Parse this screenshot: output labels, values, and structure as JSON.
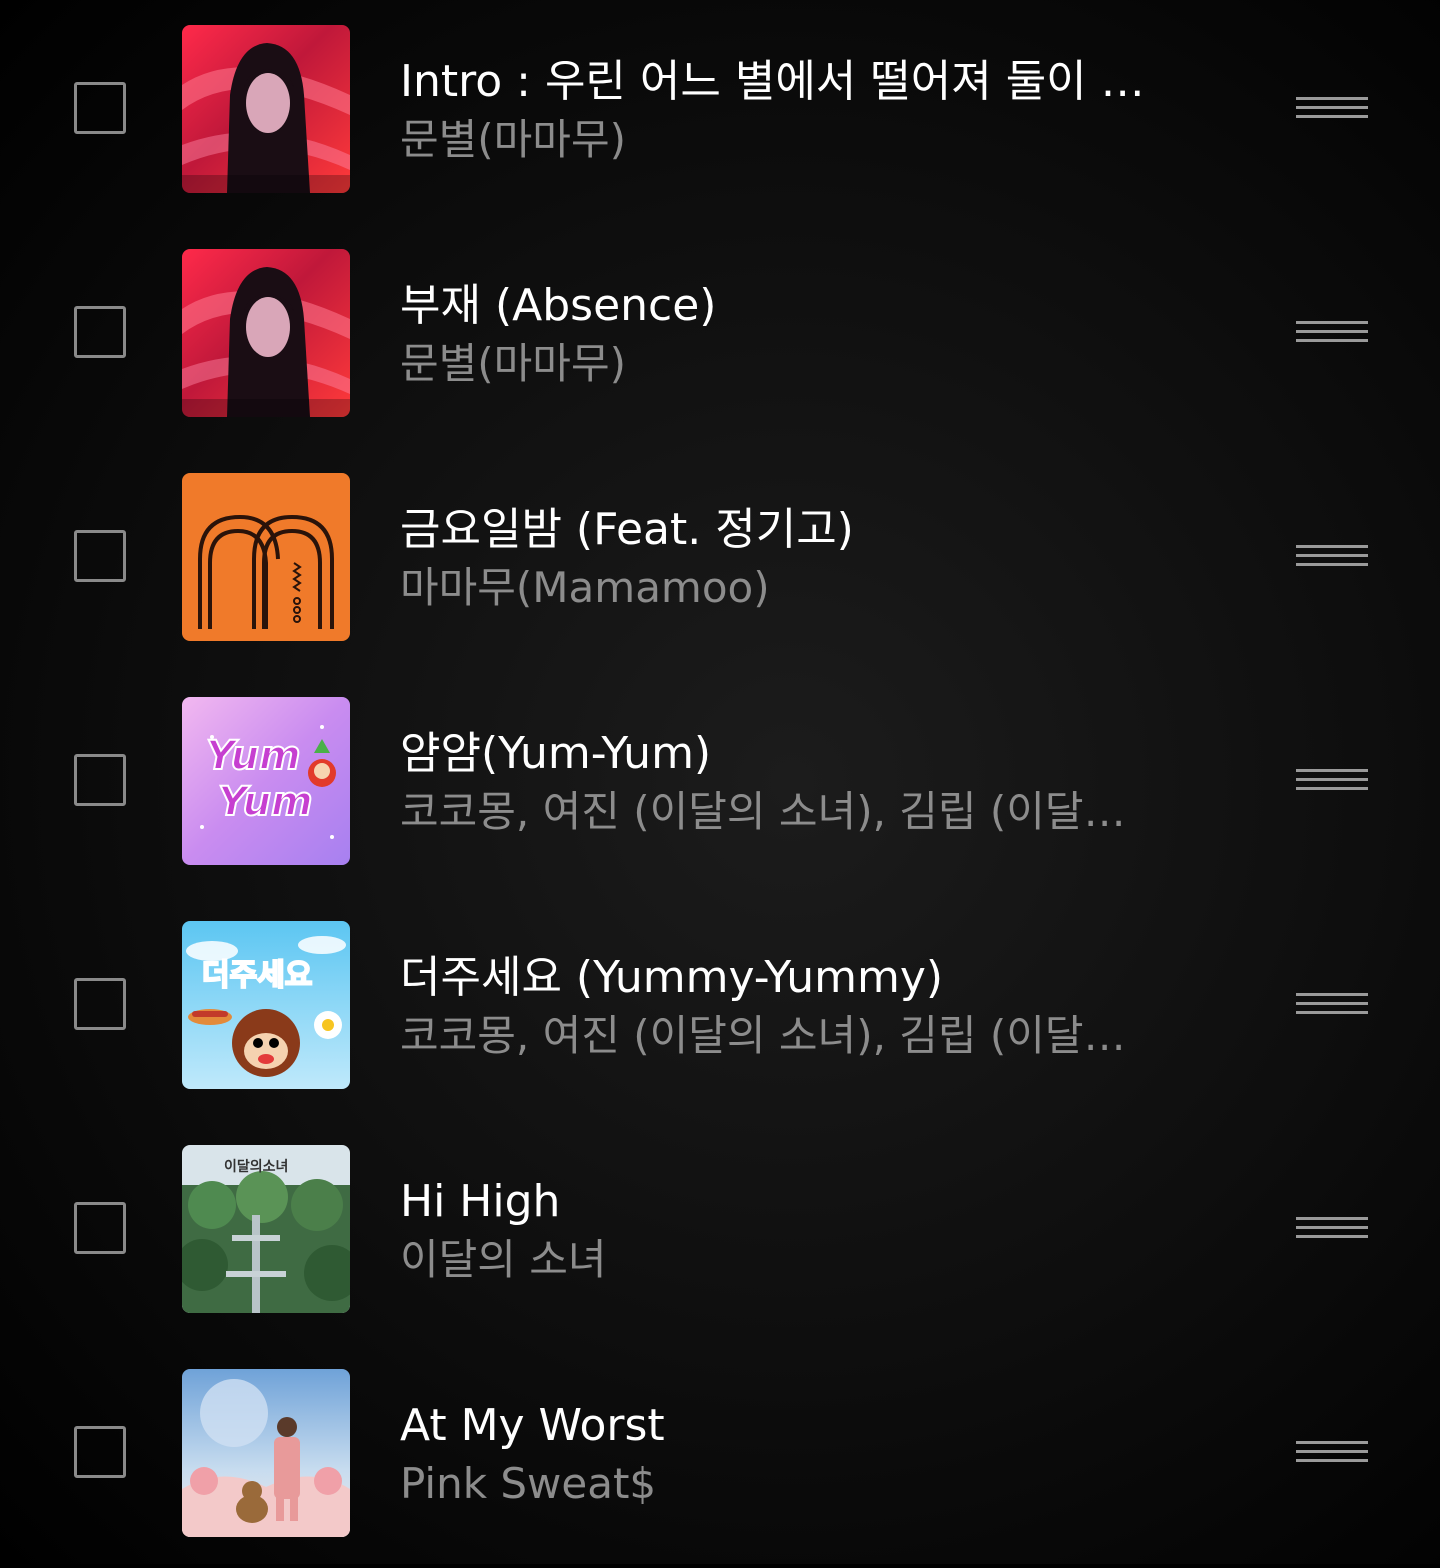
{
  "tracks": [
    {
      "title": "Intro : 우린 어느 별에서 떨어져 둘이 됐...",
      "artist": "문별(마마무)",
      "art": "moon-repackage-art"
    },
    {
      "title": "부재 (Absence)",
      "artist": "문별(마마무)",
      "art": "moon-repackage-art"
    },
    {
      "title": "금요일밤 (Feat. 정기고)",
      "artist": "마마무(Mamamoo)",
      "art": "mamamoo-orange-logo-art"
    },
    {
      "title": "얌얌(Yum-Yum)",
      "artist": "코코몽, 여진 (이달의 소녀), 김립 (이달의...",
      "art": "yum-yum-art",
      "art_text": "Yum Yum"
    },
    {
      "title": "더주세요 (Yummy-Yummy)",
      "artist": "코코몽, 여진 (이달의 소녀), 김립 (이달의...",
      "art": "yummy-yummy-art",
      "art_text": "더주세요"
    },
    {
      "title": "Hi High",
      "artist": "이달의 소녀",
      "art": "hi-high-art",
      "art_text": "이달의소녀"
    },
    {
      "title": "At My Worst",
      "artist": "Pink Sweat$",
      "art": "at-my-worst-art"
    }
  ],
  "colors": {
    "background": "#0d0d0d",
    "title": "#ffffff",
    "artist": "#8c8c8c",
    "checkbox_border": "#8a8a8a",
    "drag_handle": "#9a9a9a",
    "mamamoo_orange": "#f07a2a"
  },
  "icons": {
    "checkbox": "empty-checkbox-icon",
    "drag": "drag-handle-icon"
  }
}
